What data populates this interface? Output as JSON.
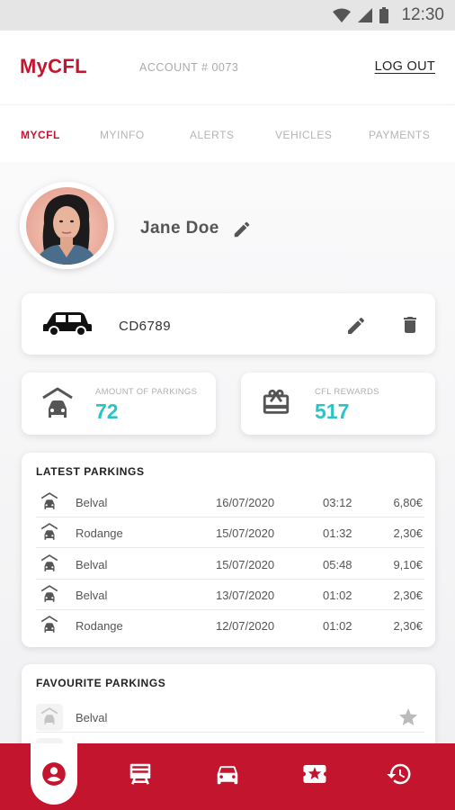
{
  "status_bar": {
    "time": "12:30",
    "icons": [
      "wifi-icon",
      "signal-icon",
      "battery-icon"
    ]
  },
  "header": {
    "brand": "MyCFL",
    "account": "ACCOUNT # 0073",
    "logout_label": "LOG OUT"
  },
  "tabs": [
    {
      "label": "MYCFL",
      "active": true
    },
    {
      "label": "MYINFO",
      "active": false
    },
    {
      "label": "ALERTS",
      "active": false
    },
    {
      "label": "VEHICLES",
      "active": false
    },
    {
      "label": "PAYMENTS",
      "active": false
    }
  ],
  "profile": {
    "name": "Jane Doe"
  },
  "vehicle": {
    "plate": "CD6789",
    "icon": "car-icon"
  },
  "stats": {
    "parkings_label": "AMOUNT OF PARKINGS",
    "parkings_value": "72",
    "rewards_label": "CFL REWARDS",
    "rewards_value": "517"
  },
  "latest_parkings": {
    "title": "LATEST PARKINGS",
    "rows": [
      {
        "place": "Belval",
        "date": "16/07/2020",
        "duration": "03:12",
        "price": "6,80€"
      },
      {
        "place": "Rodange",
        "date": "15/07/2020",
        "duration": "01:32",
        "price": "2,30€"
      },
      {
        "place": "Belval",
        "date": "15/07/2020",
        "duration": "05:48",
        "price": "9,10€"
      },
      {
        "place": "Belval",
        "date": "13/07/2020",
        "duration": "01:02",
        "price": "2,30€"
      },
      {
        "place": "Rodange",
        "date": "12/07/2020",
        "duration": "01:02",
        "price": "2,30€"
      }
    ]
  },
  "favourite_parkings": {
    "title": "FAVOURITE PARKINGS",
    "rows": [
      {
        "place": "Belval"
      }
    ]
  },
  "bottom_nav": [
    {
      "icon": "account-icon",
      "active": true
    },
    {
      "icon": "train-icon",
      "active": false
    },
    {
      "icon": "car-icon",
      "active": false
    },
    {
      "icon": "ticket-star-icon",
      "active": false
    },
    {
      "icon": "history-icon",
      "active": false
    }
  ],
  "colors": {
    "brand_red": "#c4152f",
    "accent_teal": "#2bc4c6"
  }
}
